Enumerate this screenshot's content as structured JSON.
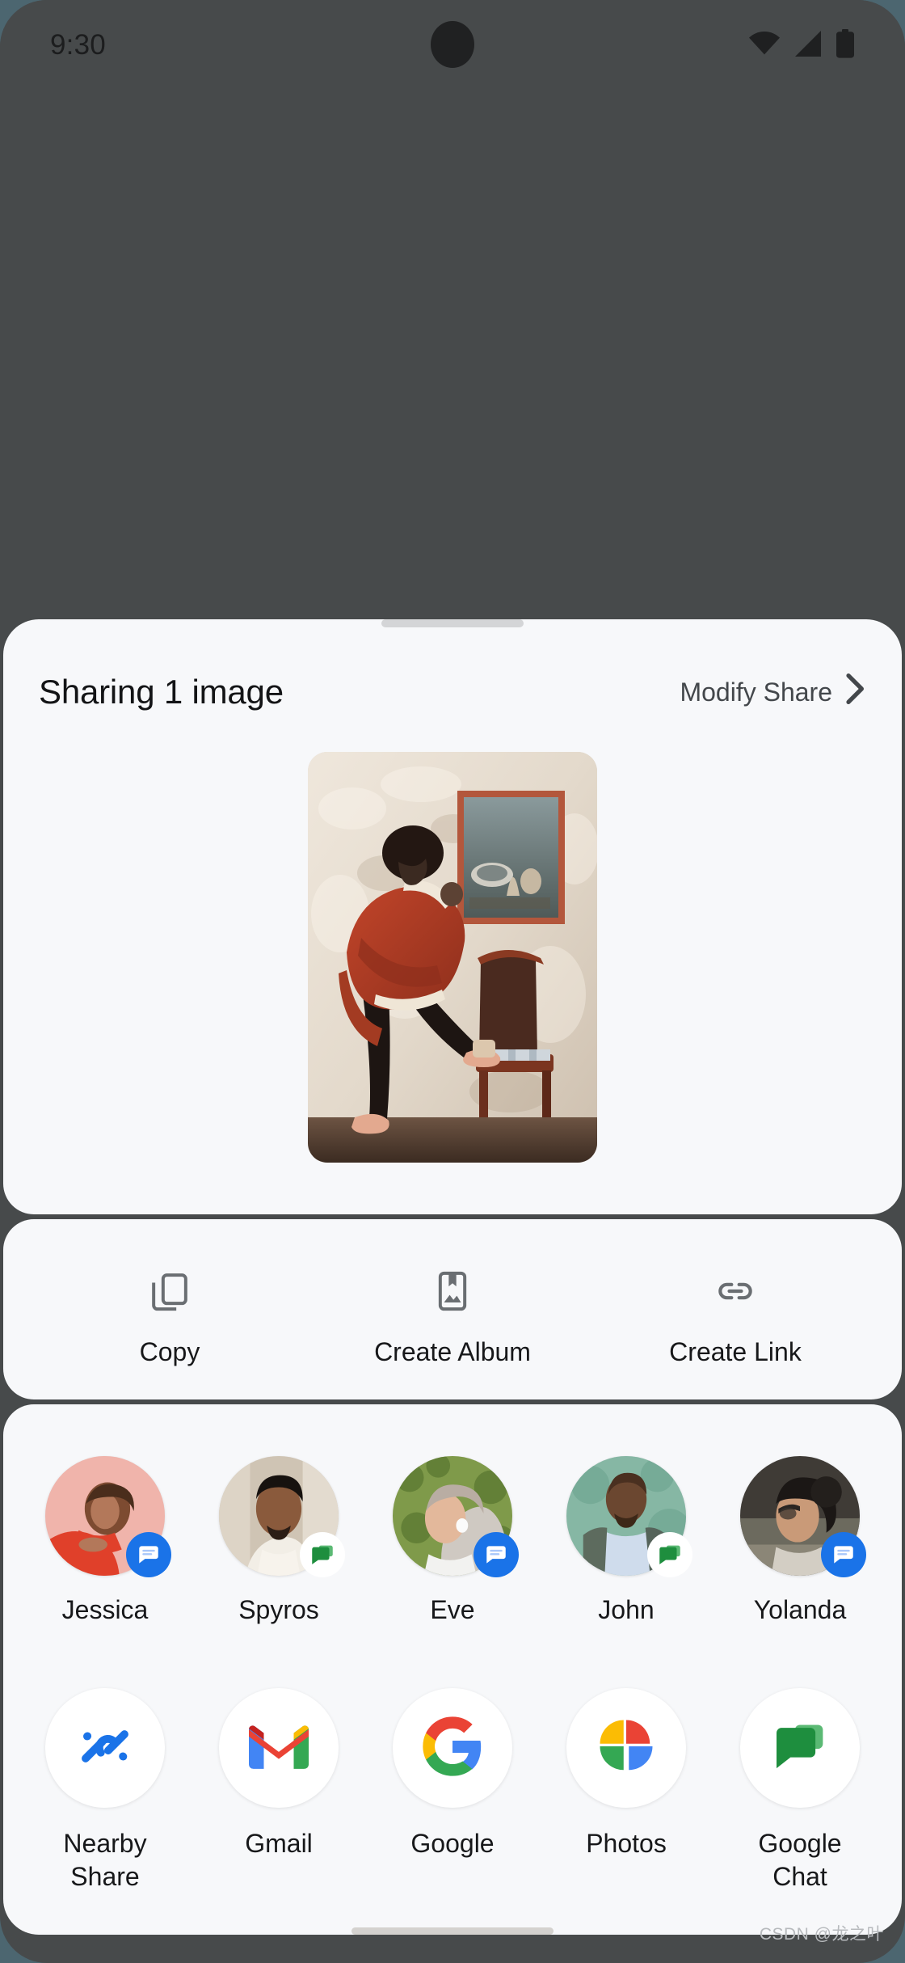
{
  "status_bar": {
    "time": "9:30",
    "icons": [
      "wifi-icon",
      "cellular-signal-icon",
      "battery-icon"
    ]
  },
  "sheet": {
    "handle": "drag-handle",
    "header": {
      "title": "Sharing 1 image",
      "modify_label": "Modify Share",
      "chevron": "chevron-right-icon"
    },
    "preview": {
      "alt": "Shared photo: person in red coat leaning on a wooden chair beside a framed painting"
    },
    "actions": [
      {
        "label": "Copy",
        "icon": "copy-icon"
      },
      {
        "label": "Create Album",
        "icon": "create-album-icon"
      },
      {
        "label": "Create Link",
        "icon": "link-icon"
      }
    ],
    "contacts": [
      {
        "name": "Jessica",
        "app_badge": "messages",
        "avatar_bg": "#f0b4ab"
      },
      {
        "name": "Spyros",
        "app_badge": "chat",
        "avatar_bg": "#cfc4b4"
      },
      {
        "name": "Eve",
        "app_badge": "messages",
        "avatar_bg": "#7f9a4a"
      },
      {
        "name": "John",
        "app_badge": "chat",
        "avatar_bg": "#86b7a4"
      },
      {
        "name": "Yolanda",
        "app_badge": "messages",
        "avatar_bg": "#3f3b36"
      }
    ],
    "apps": [
      {
        "name": "Nearby Share",
        "icon": "nearby-share-icon"
      },
      {
        "name": "Gmail",
        "icon": "gmail-icon"
      },
      {
        "name": "Google",
        "icon": "google-icon"
      },
      {
        "name": "Photos",
        "icon": "google-photos-icon"
      },
      {
        "name": "Google Chat",
        "icon": "google-chat-icon"
      }
    ]
  },
  "home_indicator": "home-indicator",
  "watermark": "CSDN @龙之叶",
  "colors": {
    "scrim": "#474a4b",
    "sheet_bg": "#f7f8fa",
    "outer_bg": "#4c6670",
    "messages_blue": "#1a73e8",
    "chat_green": "#34a853",
    "text_primary": "#17181a",
    "text_secondary": "#43474b"
  }
}
